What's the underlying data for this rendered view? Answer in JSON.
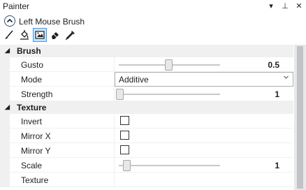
{
  "panel": {
    "title": "Painter",
    "controls": {
      "dropdown": "▾",
      "pin": "⊥",
      "close": "✕"
    }
  },
  "brush_header": {
    "label": "Left Mouse Brush",
    "collapse_icon": "chevron-up-icon"
  },
  "toolbar": {
    "tools": [
      {
        "icon": "brush-icon",
        "active": false
      },
      {
        "icon": "paint-bucket-icon",
        "active": false
      },
      {
        "icon": "texture-paint-icon",
        "active": true
      },
      {
        "icon": "eraser-icon",
        "active": false
      },
      {
        "icon": "eyedropper-icon",
        "active": false
      }
    ]
  },
  "categories": {
    "brush": {
      "name": "Brush",
      "expand_glyph": "◢",
      "props": {
        "gusto": {
          "label": "Gusto",
          "value": "0.5",
          "fraction": 0.5
        },
        "mode": {
          "label": "Mode",
          "value": "Additive"
        },
        "strength": {
          "label": "Strength",
          "value": "1",
          "fraction": 0.0
        }
      }
    },
    "texture": {
      "name": "Texture",
      "expand_glyph": "◢",
      "props": {
        "invert": {
          "label": "Invert",
          "checked": false
        },
        "mirror_x": {
          "label": "Mirror X",
          "checked": false
        },
        "mirror_y": {
          "label": "Mirror Y",
          "checked": false
        },
        "scale": {
          "label": "Scale",
          "value": "1",
          "fraction": 0.05
        },
        "texture": {
          "label": "Texture"
        }
      }
    }
  },
  "colors": {
    "accent": "#3399ff",
    "active_tool_bg": "#cce4f7",
    "category_bg": "#f0f0f0"
  }
}
